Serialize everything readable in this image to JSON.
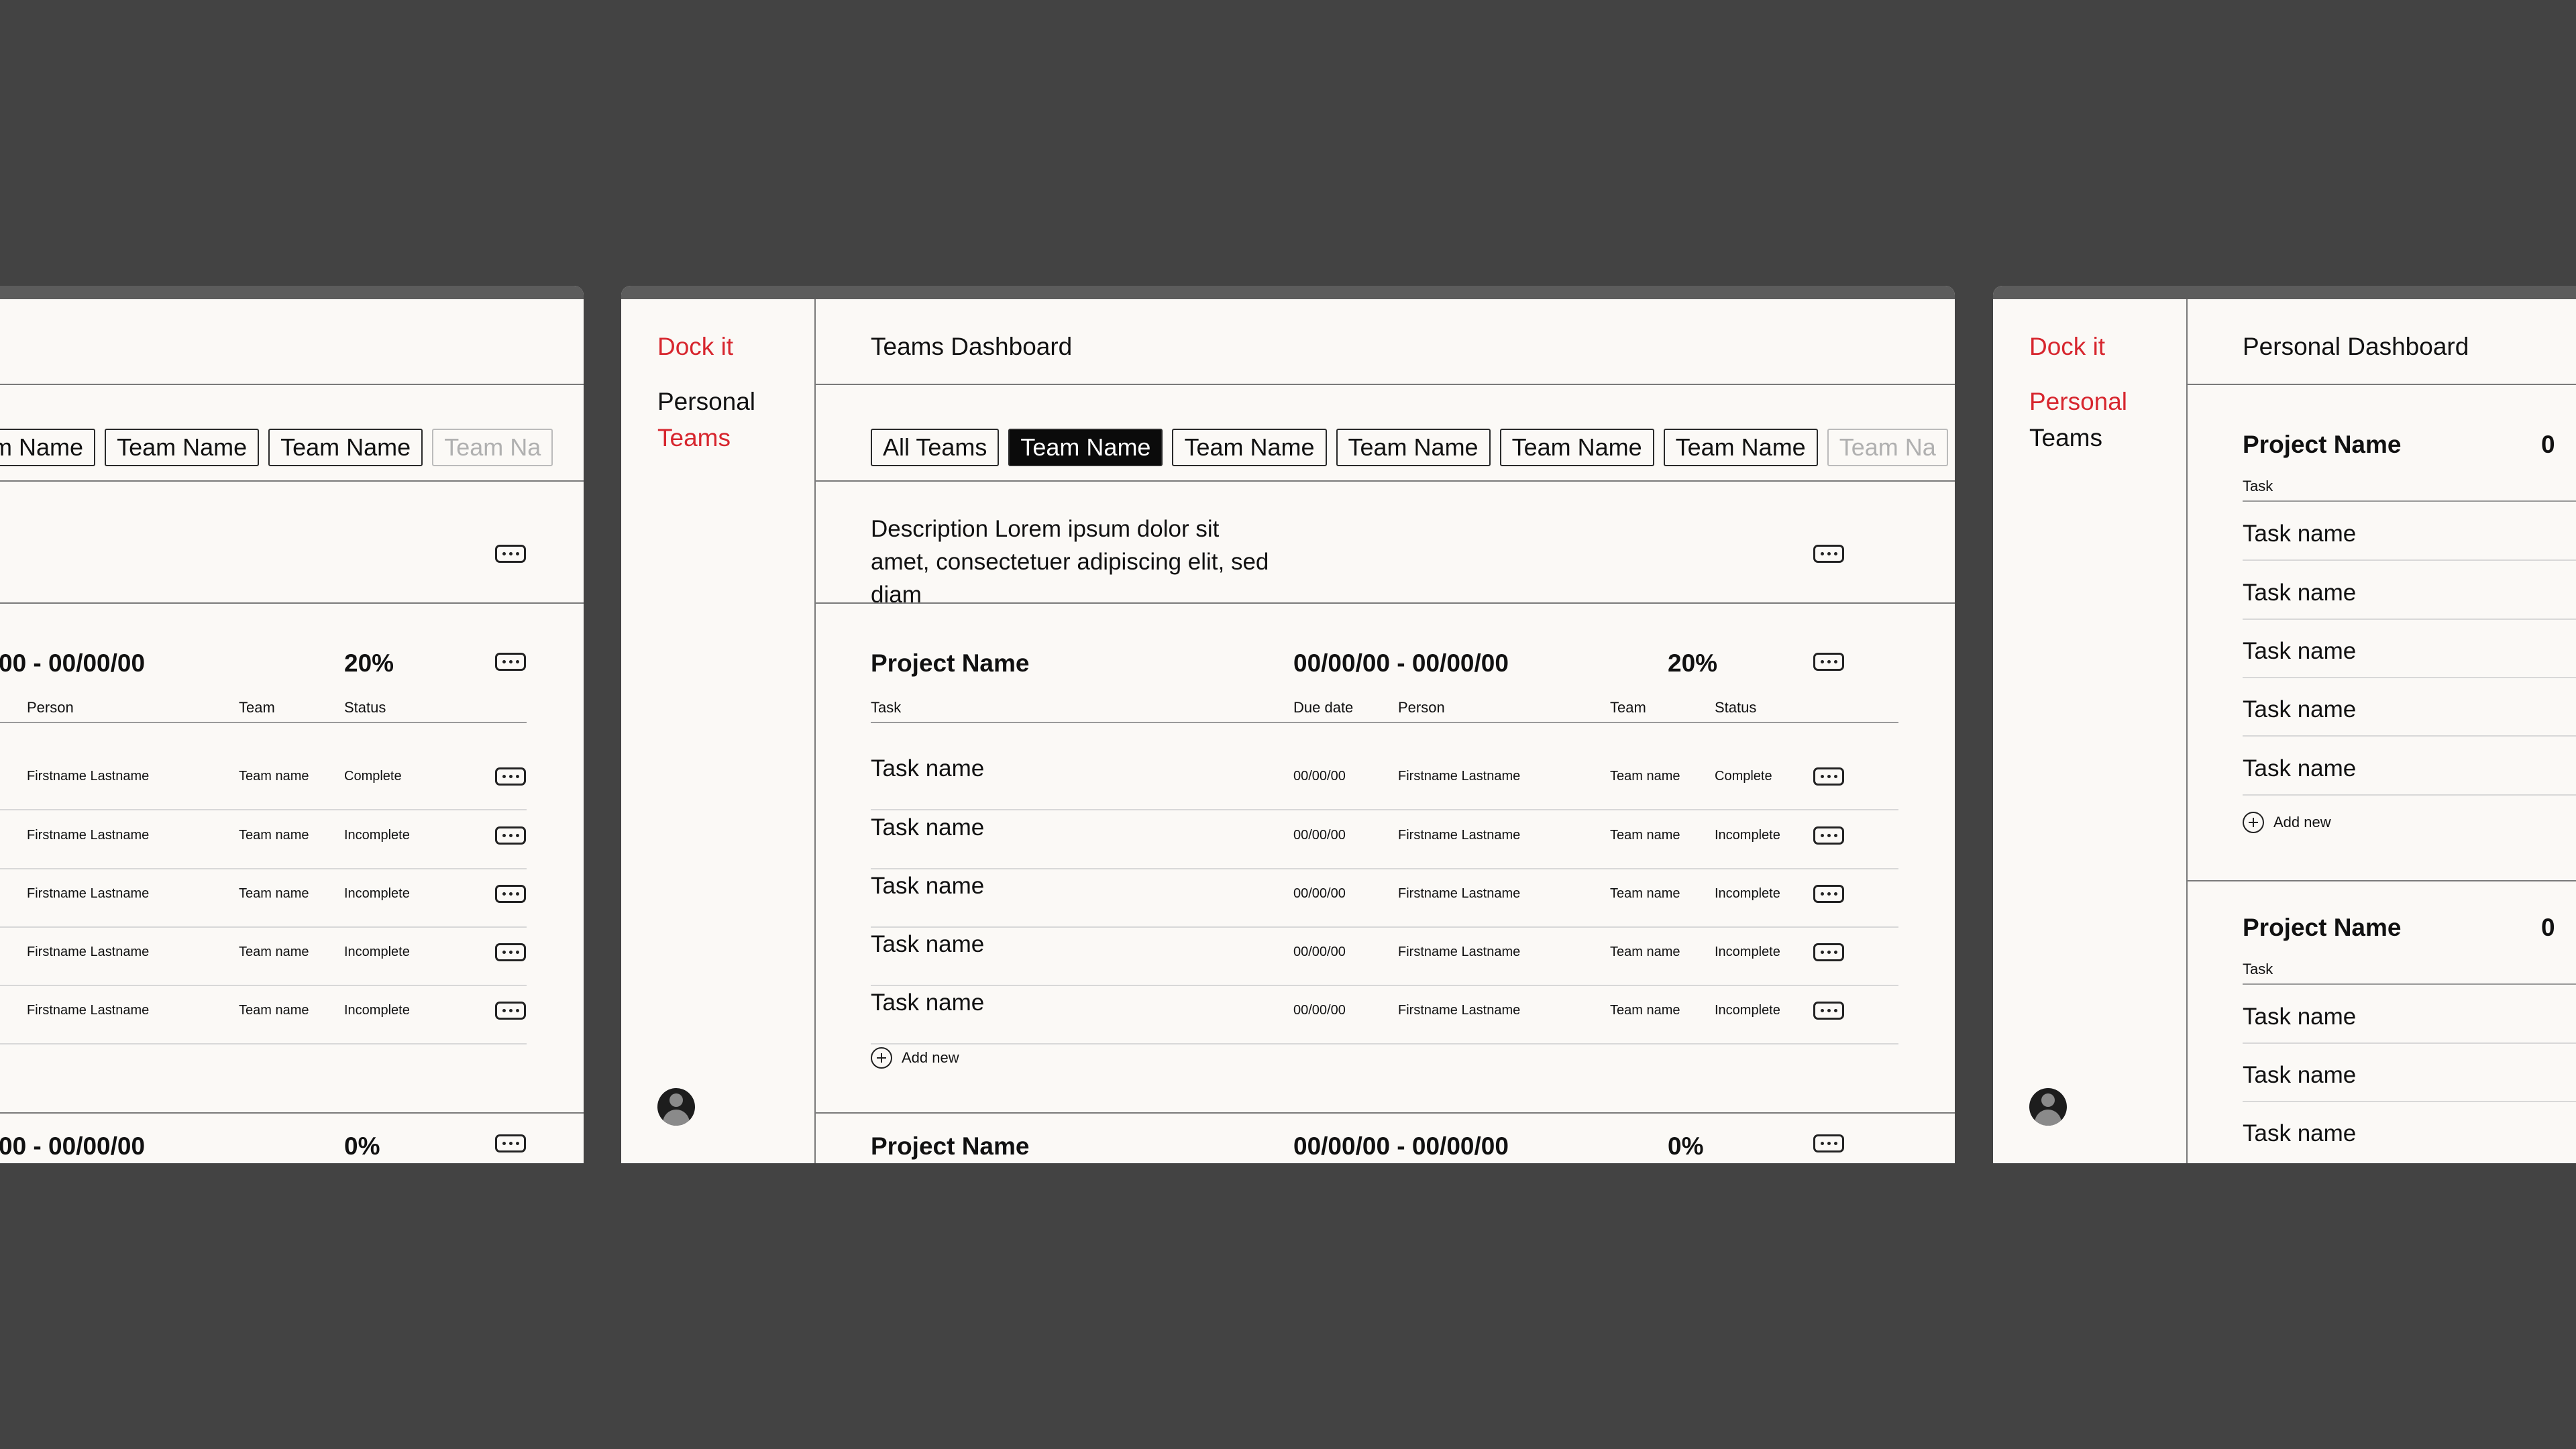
{
  "app": {
    "brand": "Dock it"
  },
  "nav": {
    "personal": "Personal",
    "teams": "Teams"
  },
  "screens": {
    "teams": {
      "title": "Teams Dashboard"
    },
    "personal": {
      "title": "Personal Dashboard"
    }
  },
  "tabs": {
    "all": "All Teams",
    "team": "Team Name",
    "cut": "Team Na",
    "cut_left": "eam Name"
  },
  "description": "Description Lorem ipsum dolor sit amet, consectetuer adipiscing elit, sed diam",
  "project": {
    "name": "Project Name",
    "dates": "00/00/00 - 00/00/00",
    "dates_cut": "00 - 00/00/00",
    "percent": "20%",
    "percent2": "0%",
    "date_cut": "0"
  },
  "columns": {
    "task": "Task",
    "due": "Due date",
    "person": "Person",
    "team": "Team",
    "status": "Status"
  },
  "rows": [
    {
      "task": "Task name",
      "due": "00/00/00",
      "person": "Firstname Lastname",
      "team": "Team name",
      "status": "Complete"
    },
    {
      "task": "Task name",
      "due": "00/00/00",
      "person": "Firstname Lastname",
      "team": "Team name",
      "status": "Incomplete"
    },
    {
      "task": "Task name",
      "due": "00/00/00",
      "person": "Firstname Lastname",
      "team": "Team name",
      "status": "Incomplete"
    },
    {
      "task": "Task name",
      "due": "00/00/00",
      "person": "Firstname Lastname",
      "team": "Team name",
      "status": "Incomplete"
    },
    {
      "task": "Task name",
      "due": "00/00/00",
      "person": "Firstname Lastname",
      "team": "Team name",
      "status": "Incomplete"
    }
  ],
  "add_new": "Add new",
  "icons": {
    "more": "more-horizontal-icon",
    "add": "plus-circle-icon",
    "avatar": "user-avatar-icon"
  },
  "colors": {
    "accent": "#d7262e",
    "background": "#434343",
    "panel": "#fbf9f6"
  }
}
